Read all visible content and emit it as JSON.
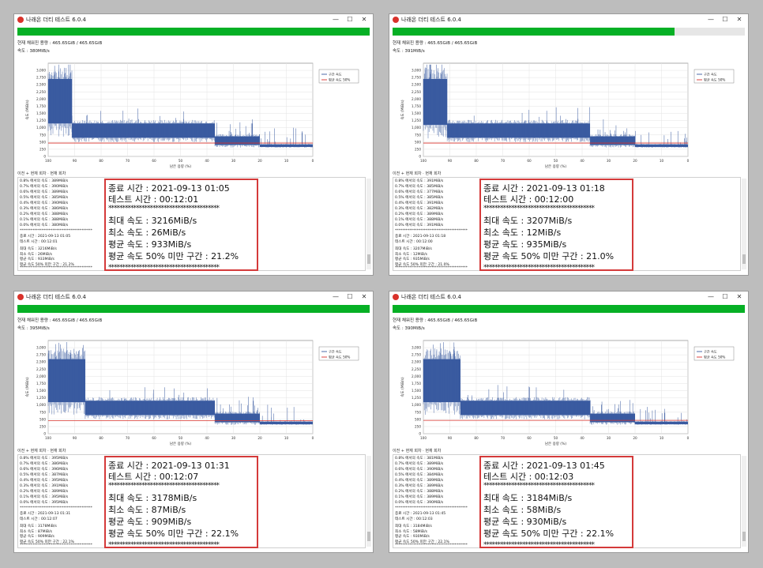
{
  "windows": [
    {
      "title": "나래온 더티 테스트 6.0.4",
      "progress": 1.0,
      "capacity_text": "현재 채워진 용량 : 465.65GiB / 465.65GiB",
      "speed_text": "속도 : 380MiB/s",
      "tabs_text": "이전 + 현재 회차 · 현재 회차",
      "log_lines": [
        "0.8% 에서의 속도 : 389MiB/s",
        "0.7% 에서의 속도 : 390MiB/s",
        "0.6% 에서의 속도 : 389MiB/s",
        "0.5% 에서의 속도 : 385MiB/s",
        "0.4% 에서의 속도 : 390MiB/s",
        "0.3% 에서의 속도 : 386MiB/s",
        "0.2% 에서의 속도 : 388MiB/s",
        "0.1% 에서의 속도 : 388MiB/s",
        "0.0% 에서의 속도 : 380MiB/s"
      ],
      "log_tail": [
        "종료 시간 : 2021-09-13 01:05",
        "테스트 시간 : 00:12:01",
        "최대 속도 : 3216MiB/s",
        "최소 속도 : 26MiB/s",
        "평균 속도 : 933MiB/s",
        "평균 속도 50% 미만 구간 : 21.2%"
      ],
      "zoom": {
        "end_time": "종료 시간 : 2021-09-13 01:05",
        "test_time": "테스트 시간 : 00:12:01",
        "max_speed": "최대 속도 : 3216MiB/s",
        "min_speed": "최소 속도 : 26MiB/s",
        "avg_speed": "평균 속도 : 933MiB/s",
        "below_half": "평균 속도 50% 미만 구간 : 21.2%"
      },
      "chart_data": {
        "type": "line",
        "xlabel": "남은 용량 (%)",
        "ylabel": "속도 (MiB/s)",
        "xlim": [
          100,
          0
        ],
        "ylim": [
          0,
          3250
        ],
        "xticks": [
          "100",
          "90",
          "80",
          "70",
          "60",
          "50",
          "40",
          "30",
          "20",
          "10",
          "0"
        ],
        "yticks": [
          "0",
          "250",
          "500",
          "750",
          "1,000",
          "1,250",
          "1,500",
          "1,750",
          "2,000",
          "2,250",
          "2,500",
          "2,750",
          "3,000"
        ],
        "legend_position": "top-right",
        "series": [
          {
            "name": "구간 속도",
            "color": "#3a5ba0",
            "segments": [
              {
                "from": 100,
                "to": 91,
                "low": 1150,
                "high": 2700
              },
              {
                "from": 91,
                "to": 37,
                "low": 650,
                "high": 1150
              },
              {
                "from": 37,
                "to": 20,
                "low": 400,
                "high": 700
              },
              {
                "from": 20,
                "to": 0,
                "low": 330,
                "high": 420
              }
            ]
          },
          {
            "name": "평균 속도 50%",
            "color": "#d9322b",
            "value": 466
          }
        ]
      }
    },
    {
      "title": "나래온 더티 테스트 6.0.4",
      "progress": 0.8,
      "capacity_text": "현재 채워진 용량 : 465.65GiB / 465.65GiB",
      "speed_text": "속도 : 391MiB/s",
      "tabs_text": "이전 + 현재 회차 · 현재 회차",
      "log_lines": [
        "0.8% 에서의 속도 : 391MiB/s",
        "0.7% 에서의 속도 : 385MiB/s",
        "0.6% 에서의 속도 : 377MiB/s",
        "0.5% 에서의 속도 : 385MiB/s",
        "0.4% 에서의 속도 : 391MiB/s",
        "0.3% 에서의 속도 : 382MiB/s",
        "0.2% 에서의 속도 : 389MiB/s",
        "0.1% 에서의 속도 : 388MiB/s",
        "0.0% 에서의 속도 : 391MiB/s"
      ],
      "log_tail": [
        "종료 시간 : 2021-09-13 01:18",
        "테스트 시간 : 00:12:00",
        "최대 속도 : 3207MiB/s",
        "최소 속도 : 12MiB/s",
        "평균 속도 : 935MiB/s",
        "평균 속도 50% 미만 구간 : 21.0%"
      ],
      "zoom": {
        "end_time": "종료 시간 : 2021-09-13 01:18",
        "test_time": "테스트 시간 : 00:12:00",
        "max_speed": "최대 속도 : 3207MiB/s",
        "min_speed": "최소 속도 : 12MiB/s",
        "avg_speed": "평균 속도 : 935MiB/s",
        "below_half": "평균 속도 50% 미만 구간 : 21.0%"
      },
      "chart_data": {
        "type": "line",
        "xlabel": "남은 용량 (%)",
        "ylabel": "속도 (MiB/s)",
        "xlim": [
          100,
          0
        ],
        "ylim": [
          0,
          3250
        ],
        "xticks": [
          "100",
          "90",
          "80",
          "70",
          "60",
          "50",
          "40",
          "30",
          "20",
          "10",
          "0"
        ],
        "yticks": [
          "0",
          "250",
          "500",
          "750",
          "1,000",
          "1,250",
          "1,500",
          "1,750",
          "2,000",
          "2,250",
          "2,500",
          "2,750",
          "3,000"
        ],
        "legend_position": "top-right",
        "series": [
          {
            "name": "구간 속도",
            "color": "#3a5ba0",
            "segments": [
              {
                "from": 100,
                "to": 91,
                "low": 1100,
                "high": 2700
              },
              {
                "from": 91,
                "to": 37,
                "low": 650,
                "high": 1150
              },
              {
                "from": 37,
                "to": 20,
                "low": 400,
                "high": 700
              },
              {
                "from": 20,
                "to": 0,
                "low": 330,
                "high": 420
              }
            ]
          },
          {
            "name": "평균 속도 50%",
            "color": "#d9322b",
            "value": 467
          }
        ]
      }
    },
    {
      "title": "나래온 더티 테스트 6.0.4",
      "progress": 1.0,
      "capacity_text": "현재 채워진 용량 : 465.65GiB / 465.65GiB",
      "speed_text": "속도 : 395MiB/s",
      "tabs_text": "이전 + 현재 회차 · 현재 회차",
      "log_lines": [
        "0.8% 에서의 속도 : 395MiB/s",
        "0.7% 에서의 속도 : 386MiB/s",
        "0.6% 에서의 속도 : 396MiB/s",
        "0.5% 에서의 속도 : 387MiB/s",
        "0.4% 에서의 속도 : 395MiB/s",
        "0.3% 에서의 속도 : 391MiB/s",
        "0.2% 에서의 속도 : 389MiB/s",
        "0.1% 에서의 속도 : 395MiB/s",
        "0.0% 에서의 속도 : 395MiB/s"
      ],
      "log_tail": [
        "종료 시간 : 2021-09-13 01:31",
        "테스트 시간 : 00:12:07",
        "최대 속도 : 3178MiB/s",
        "최소 속도 : 87MiB/s",
        "평균 속도 : 909MiB/s",
        "평균 속도 50% 미만 구간 : 22.1%"
      ],
      "zoom": {
        "end_time": "종료 시간 : 2021-09-13 01:31",
        "test_time": "테스트 시간 : 00:12:07",
        "max_speed": "최대 속도 : 3178MiB/s",
        "min_speed": "최소 속도 : 87MiB/s",
        "avg_speed": "평균 속도 : 909MiB/s",
        "below_half": "평균 속도 50% 미만 구간 : 22.1%"
      },
      "chart_data": {
        "type": "line",
        "xlabel": "남은 용량 (%)",
        "ylabel": "속도 (MiB/s)",
        "xlim": [
          100,
          0
        ],
        "ylim": [
          0,
          3250
        ],
        "xticks": [
          "100",
          "90",
          "80",
          "70",
          "60",
          "50",
          "40",
          "30",
          "20",
          "10",
          "0"
        ],
        "yticks": [
          "0",
          "250",
          "500",
          "750",
          "1,000",
          "1,250",
          "1,500",
          "1,750",
          "2,000",
          "2,250",
          "2,500",
          "2,750",
          "3,000"
        ],
        "legend_position": "top-right",
        "series": [
          {
            "name": "구간 속도",
            "color": "#3a5ba0",
            "segments": [
              {
                "from": 100,
                "to": 86,
                "low": 1100,
                "high": 2600
              },
              {
                "from": 86,
                "to": 37,
                "low": 650,
                "high": 1150
              },
              {
                "from": 37,
                "to": 20,
                "low": 400,
                "high": 700
              },
              {
                "from": 20,
                "to": 0,
                "low": 330,
                "high": 420
              }
            ]
          },
          {
            "name": "평균 속도 50%",
            "color": "#d9322b",
            "value": 455
          }
        ]
      }
    },
    {
      "title": "나래온 더티 테스트 6.0.4",
      "progress": 1.0,
      "capacity_text": "현재 채워진 용량 : 465.65GiB / 465.65GiB",
      "speed_text": "속도 : 390MiB/s",
      "tabs_text": "이전 + 현재 회차 · 현재 회차",
      "log_lines": [
        "0.8% 에서의 속도 : 381MiB/s",
        "0.7% 에서의 속도 : 389MiB/s",
        "0.6% 에서의 속도 : 390MiB/s",
        "0.5% 에서의 속도 : 384MiB/s",
        "0.4% 에서의 속도 : 389MiB/s",
        "0.3% 에서의 속도 : 389MiB/s",
        "0.2% 에서의 속도 : 388MiB/s",
        "0.1% 에서의 속도 : 389MiB/s",
        "0.0% 에서의 속도 : 390MiB/s"
      ],
      "log_tail": [
        "종료 시간 : 2021-09-13 01:45",
        "테스트 시간 : 00:12:03",
        "최대 속도 : 3184MiB/s",
        "최소 속도 : 58MiB/s",
        "평균 속도 : 930MiB/s",
        "평균 속도 50% 미만 구간 : 22.1%"
      ],
      "zoom": {
        "end_time": "종료 시간 : 2021-09-13 01:45",
        "test_time": "테스트 시간 : 00:12:03",
        "max_speed": "최대 속도 : 3184MiB/s",
        "min_speed": "최소 속도 : 58MiB/s",
        "avg_speed": "평균 속도 : 930MiB/s",
        "below_half": "평균 속도 50% 미만 구간 : 22.1%"
      },
      "chart_data": {
        "type": "line",
        "xlabel": "남은 용량 (%)",
        "ylabel": "속도 (MiB/s)",
        "xlim": [
          100,
          0
        ],
        "ylim": [
          0,
          3250
        ],
        "xticks": [
          "100",
          "90",
          "80",
          "70",
          "60",
          "50",
          "40",
          "30",
          "20",
          "10",
          "0"
        ],
        "yticks": [
          "0",
          "250",
          "500",
          "750",
          "1,000",
          "1,250",
          "1,500",
          "1,750",
          "2,000",
          "2,250",
          "2,500",
          "2,750",
          "3,000"
        ],
        "legend_position": "top-right",
        "series": [
          {
            "name": "구간 속도",
            "color": "#3a5ba0",
            "segments": [
              {
                "from": 100,
                "to": 86,
                "low": 1100,
                "high": 2600
              },
              {
                "from": 86,
                "to": 37,
                "low": 650,
                "high": 1150
              },
              {
                "from": 37,
                "to": 20,
                "low": 400,
                "high": 700
              },
              {
                "from": 20,
                "to": 0,
                "low": 330,
                "high": 420
              }
            ]
          },
          {
            "name": "평균 속도 50%",
            "color": "#d9322b",
            "value": 465
          }
        ]
      }
    }
  ],
  "icons": {
    "app": "app-icon",
    "minimize": "minimize-icon",
    "maximize": "maximize-icon",
    "close": "close-icon"
  },
  "stars": "****************************************",
  "titlebar_glyphs": {
    "minimize": "—",
    "maximize": "☐",
    "close": "✕"
  }
}
